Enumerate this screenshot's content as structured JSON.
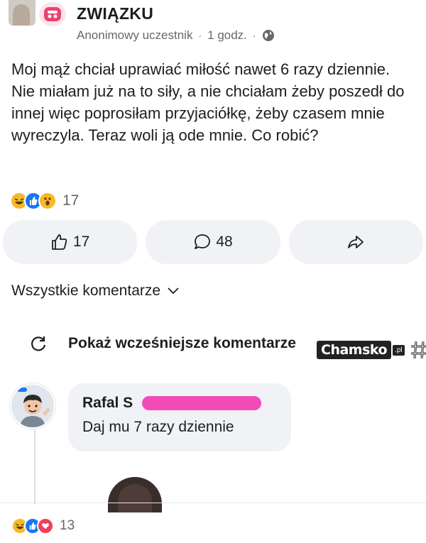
{
  "post": {
    "group_name": "ZWIĄZKU",
    "author": "Anonimowy uczestnik",
    "time": "1 godz.",
    "separator": "·",
    "audience_icon": "globe-icon",
    "text": "Moj mąż chciał uprawiać miłość nawet 6 razy dziennie. Nie miałam już na to siły, a nie chciałam żeby poszedł do innej więc poprosiłam przyjaciółkę, żeby czasem mnie wyreczyla. Teraz woli ją ode mnie. Co robić?",
    "reaction_count": "17",
    "reaction_icons": [
      "haha-reaction-icon",
      "like-reaction-icon",
      "wow-reaction-icon"
    ]
  },
  "actions": {
    "like_count": "17",
    "comment_count": "48",
    "share_icon": "share-icon"
  },
  "comments_filter": {
    "label": "Wszystkie komentarze"
  },
  "show_previous": {
    "label": "Pokaż wcześniejsze komentarze"
  },
  "watermark": {
    "text": "Chamsko",
    "tld": ".pl"
  },
  "comment": {
    "author": "Rafal S",
    "text": "Daj mu 7 razy dziennie",
    "reaction_count": "13",
    "reaction_icons": [
      "haha-reaction-icon",
      "like-reaction-icon",
      "love-reaction-icon"
    ]
  },
  "colors": {
    "accent_blue": "#1877f2",
    "reaction_yellow": "#f7b928",
    "love_red": "#f33e58",
    "redaction_pink": "#f24bb8",
    "button_bg": "#f0f2f5",
    "muted_text": "#65676b"
  }
}
